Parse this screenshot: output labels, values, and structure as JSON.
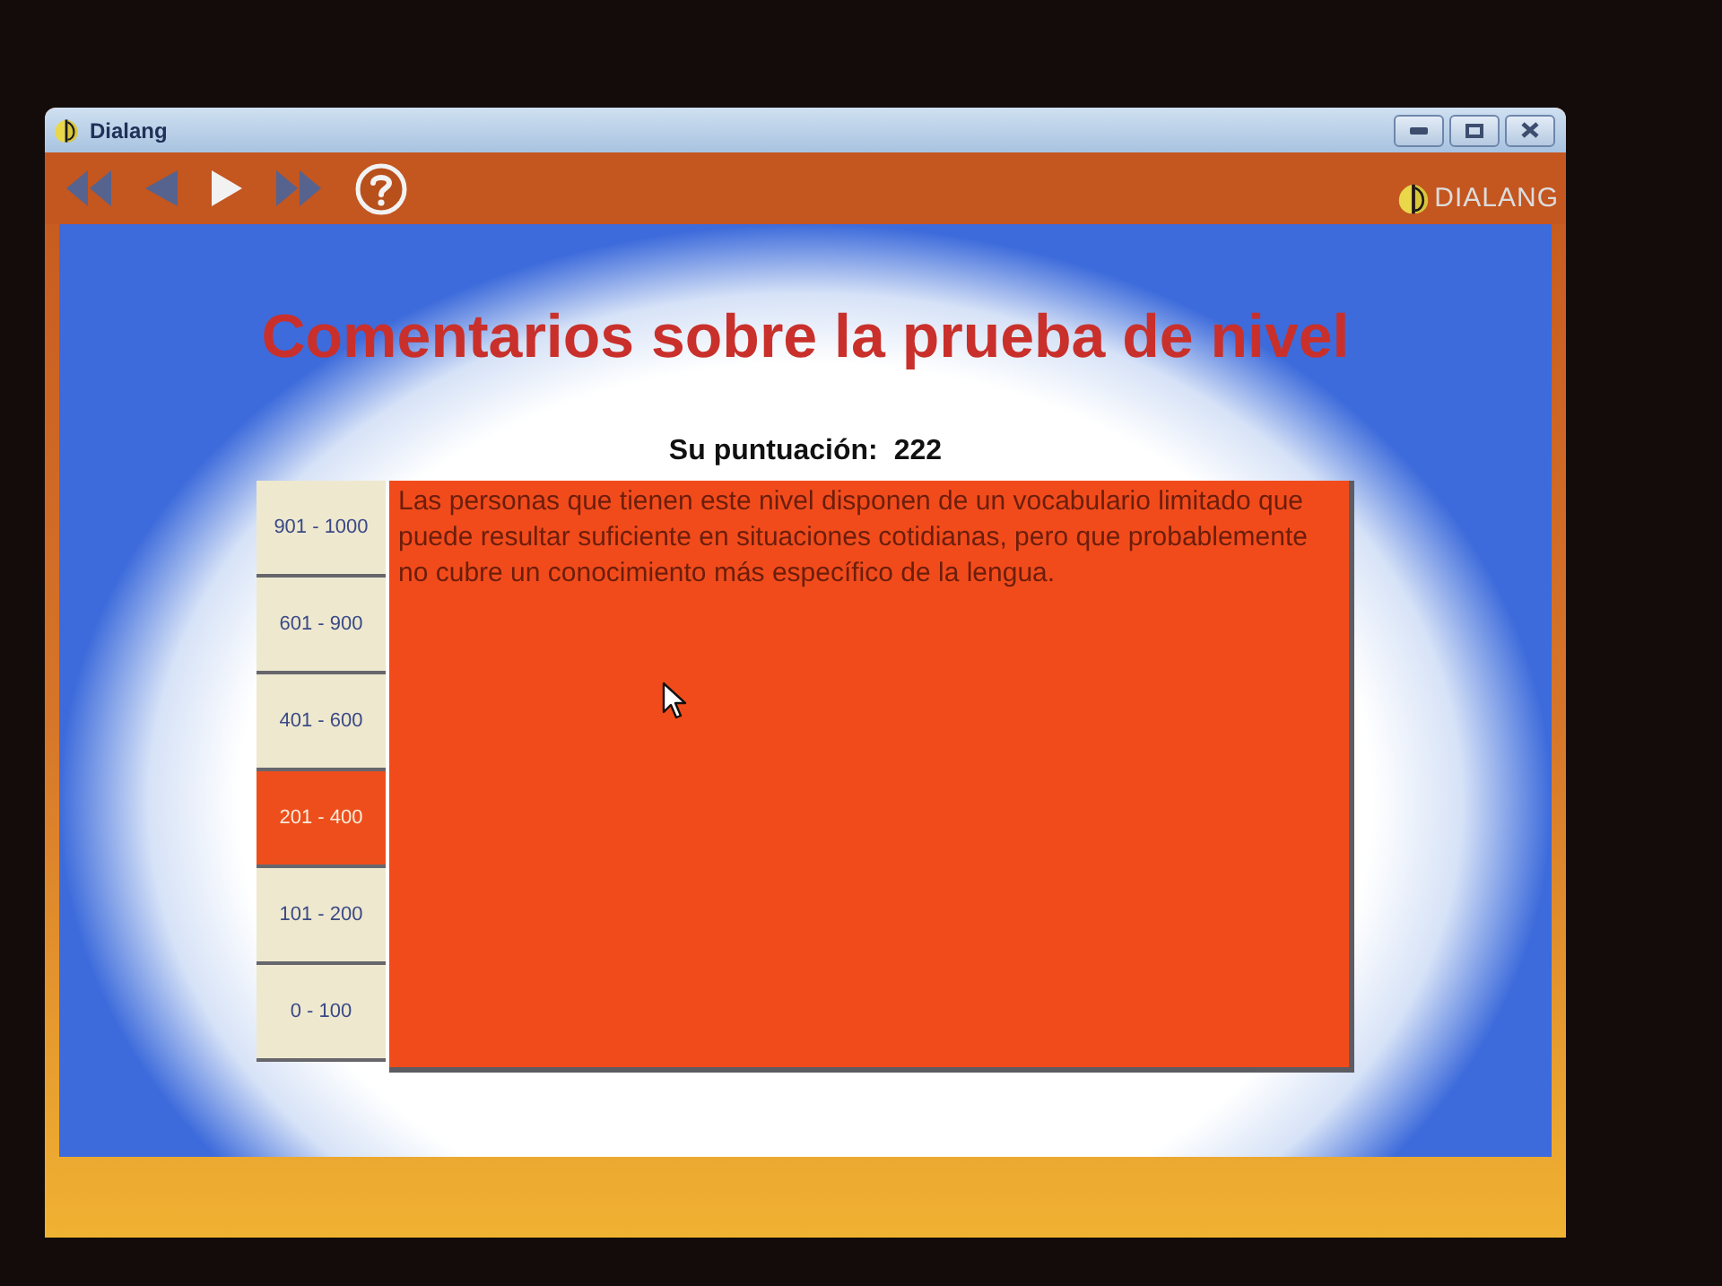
{
  "window": {
    "title": "Dialang",
    "controls": [
      {
        "kind": "minimize"
      },
      {
        "kind": "maximize"
      },
      {
        "kind": "close"
      }
    ]
  },
  "toolbar": {
    "buttons": [
      {
        "kind": "first",
        "disabled": true
      },
      {
        "kind": "previous",
        "disabled": true
      },
      {
        "kind": "next",
        "disabled": false
      },
      {
        "kind": "last",
        "disabled": true
      },
      {
        "kind": "help",
        "disabled": false
      }
    ],
    "logo": "DIALANG"
  },
  "page": {
    "heading": "Comentarios sobre la prueba de nivel",
    "score_label": "Su puntuación:",
    "score": "222",
    "bands": [
      {
        "label": "901 - 1000",
        "selected": false
      },
      {
        "label": "601 - 900",
        "selected": false
      },
      {
        "label": "401 - 600",
        "selected": false
      },
      {
        "label": "201 - 400",
        "selected": true
      },
      {
        "label": "101 - 200",
        "selected": false
      },
      {
        "label": "0 - 100",
        "selected": false
      }
    ],
    "description": "Las personas que tienen este nivel disponen de un vocabulario limitado que puede resultar suficiente en situaciones cotidianas, pero que probablemente no cubre un conocimiento más específico de la lengua."
  }
}
